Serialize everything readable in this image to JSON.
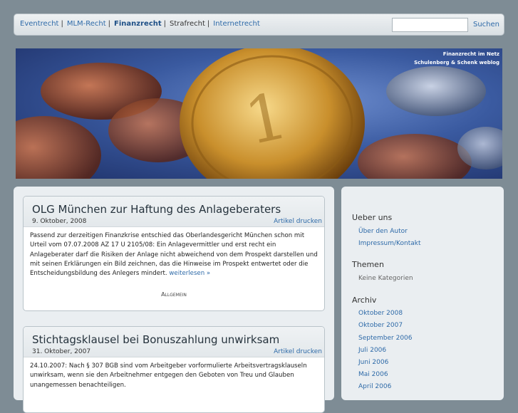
{
  "nav": {
    "items": [
      {
        "label": "Eventrecht",
        "style": "link"
      },
      {
        "label": "MLM-Recht",
        "style": "link"
      },
      {
        "label": "Finanzrecht",
        "style": "active"
      },
      {
        "label": "Strafrecht",
        "style": "plain"
      },
      {
        "label": "Internetrecht",
        "style": "link"
      }
    ],
    "separator": "|",
    "search_button": "Suchen"
  },
  "header": {
    "title_line1": "Finanzrecht im Netz",
    "title_line2": "Schulenberg & Schenk weblog"
  },
  "posts": [
    {
      "title": "OLG München zur Haftung des Anlageberaters",
      "date": "9. Oktober, 2008",
      "print_label": "Artikel drucken",
      "body": "Passend zur derzeitigen Finanzkrise entschied das Oberlandesgericht München schon mit Urteil vom 07.07.2008 AZ 17 U 2105/08: Ein Anlagevermittler und erst recht ein Anlageberater darf die Risiken der Anlage nicht abweichend von dem Prospekt darstellen und mit seinen Erklärungen ein Bild zeichnen, das die Hinweise im Prospekt entwertet oder die Entscheidungsbildung des Anlegers mindert.",
      "more_label": "weiterlesen »",
      "category": "Allgemein"
    },
    {
      "title": "Stichtagsklausel bei Bonuszahlung unwirksam",
      "date": "31. Oktober, 2007",
      "print_label": "Artikel drucken",
      "body": "24.10.2007: Nach § 307 BGB sind vom Arbeitgeber vorformulierte Arbeitsvertragsklauseln unwirksam, wenn sie den Arbeitnehmer entgegen den Geboten von Treu und Glauben unangemessen benachteiligen."
    }
  ],
  "sidebar": {
    "about_heading": "Ueber uns",
    "about_links": [
      "Über den Autor",
      "Impressum/Kontakt"
    ],
    "themes_heading": "Themen",
    "themes_empty": "Keine Kategorien",
    "archive_heading": "Archiv",
    "archive_links": [
      "Oktober 2008",
      "Oktober 2007",
      "September 2006",
      "Juli 2006",
      "Juni 2006",
      "Mai 2006",
      "April 2006"
    ]
  },
  "colors": {
    "link": "#2e6aa8",
    "background": "#7e8c95",
    "panel": "#eaeef1"
  }
}
